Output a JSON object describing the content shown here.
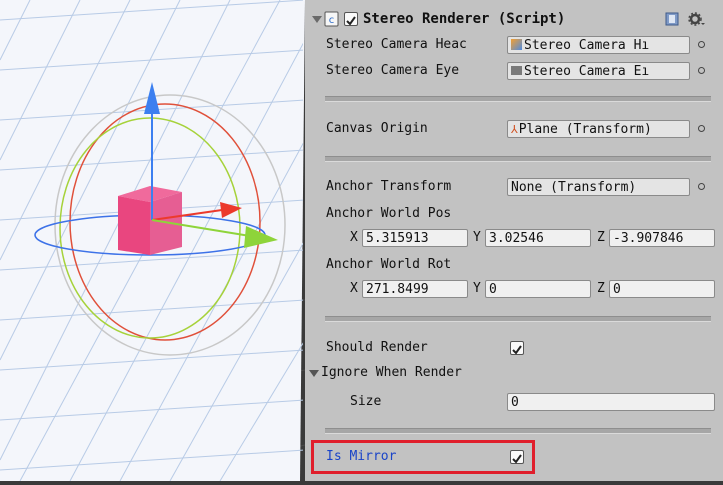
{
  "component": {
    "title": "Stereo Renderer (Script)",
    "script_icon": "script-file-icon",
    "help_icon": "help-book-icon",
    "settings_icon": "gear-icon"
  },
  "fields": {
    "head_label": "Stereo Camera Heac",
    "head_value": "Stereo Camera Hı",
    "eye_label": "Stereo Camera Eye",
    "eye_value": "Stereo Camera Eı",
    "canvas_label": "Canvas Origin",
    "canvas_value": "Plane (Transform)",
    "anchor_label": "Anchor Transform",
    "anchor_value": "None (Transform)",
    "pos_label": "Anchor World Pos",
    "pos_x": "5.315913",
    "pos_y": "3.02546",
    "pos_z": "-3.907846",
    "rot_label": "Anchor World Rot",
    "rot_x": "271.8499",
    "rot_y": "0",
    "rot_z": "0",
    "axis_x": "X",
    "axis_y": "Y",
    "axis_z": "Z",
    "should_render_label": "Should Render",
    "should_render": true,
    "ignore_label": "Ignore When Render",
    "size_label": "Size",
    "size_value": "0",
    "mirror_label": "Is Mirror",
    "is_mirror": true
  },
  "colors": {
    "panel_bg": "#c2c2c2",
    "highlight_border": "#e01f2c",
    "mirror_label": "#1a44c8"
  }
}
